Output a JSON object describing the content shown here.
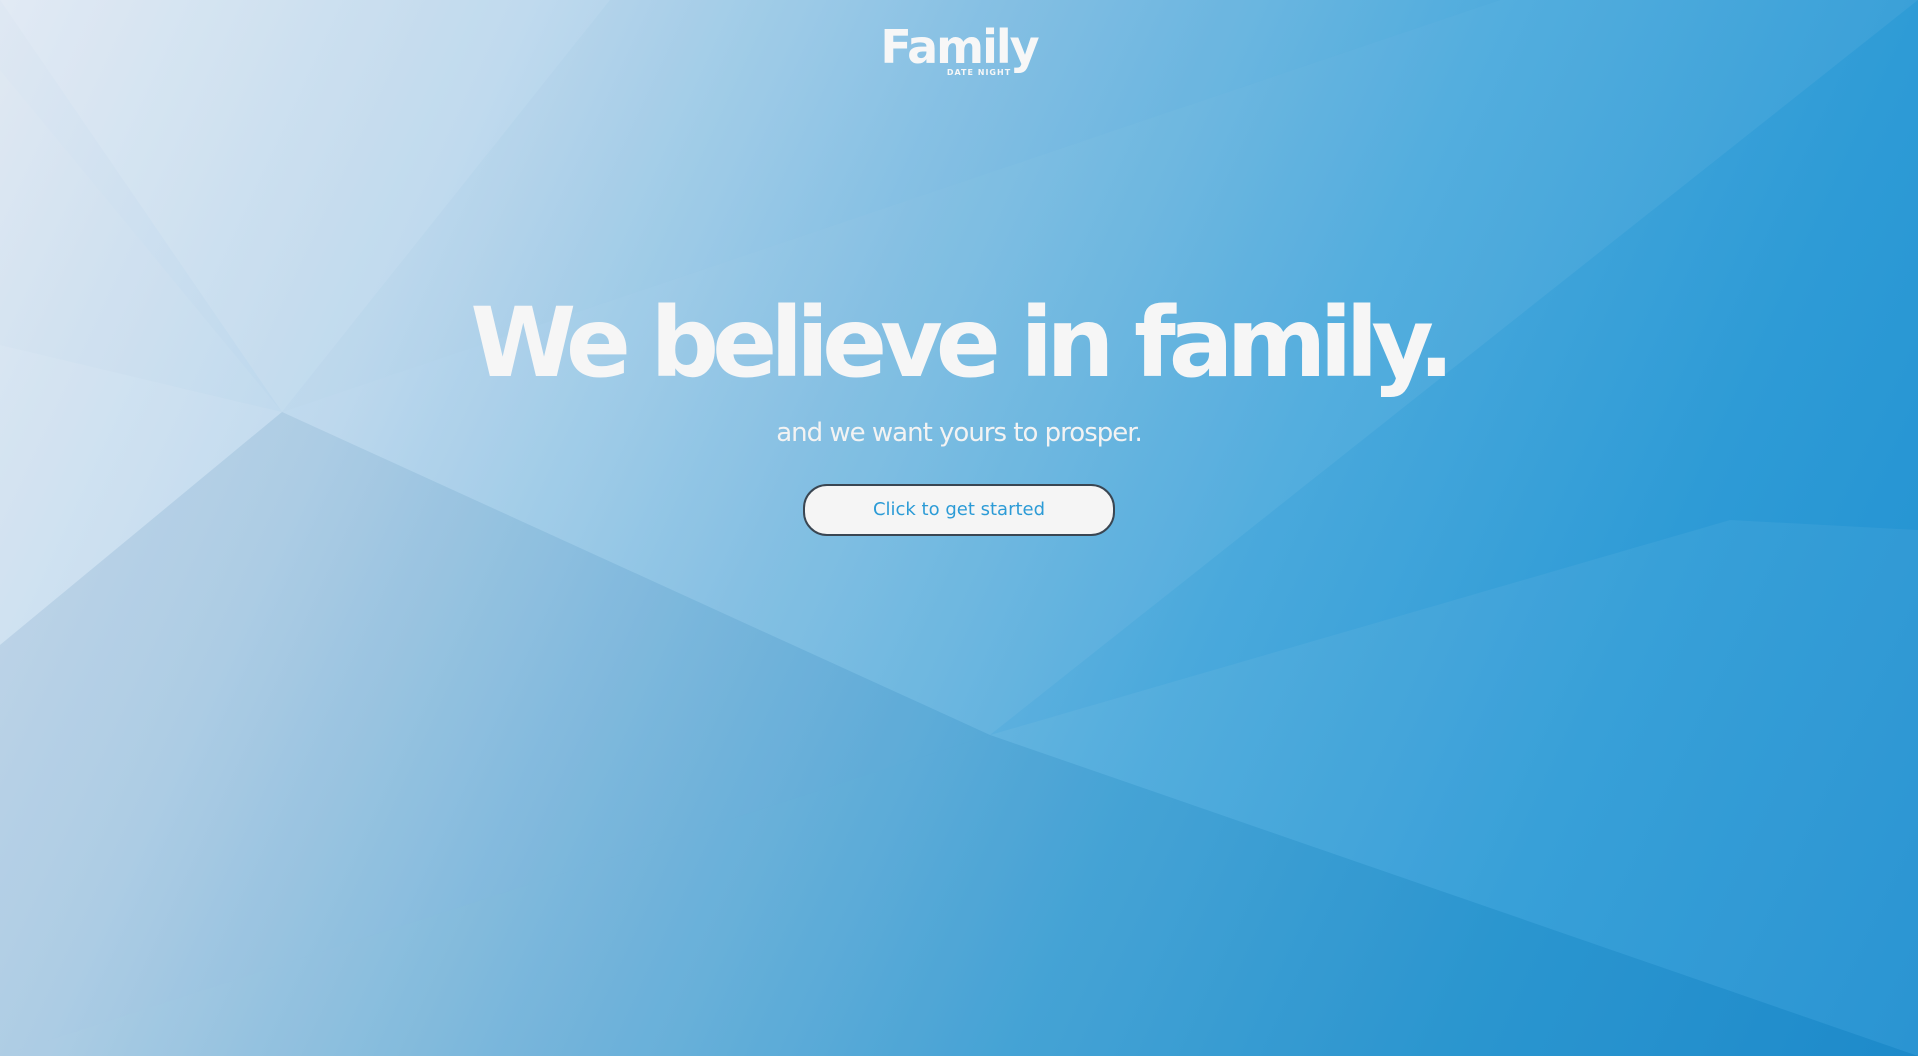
{
  "logo": {
    "word": "Family",
    "tagline": "DATE NIGHT"
  },
  "hero": {
    "headline": "We believe in family.",
    "subline": "and we want yours to prosper.",
    "cta_label": "Click to get started"
  },
  "colors": {
    "accent": "#2c9bd6",
    "background_light": "#dfe8f3",
    "background_dark": "#1f8fd0",
    "text": "#f6f6f6"
  }
}
